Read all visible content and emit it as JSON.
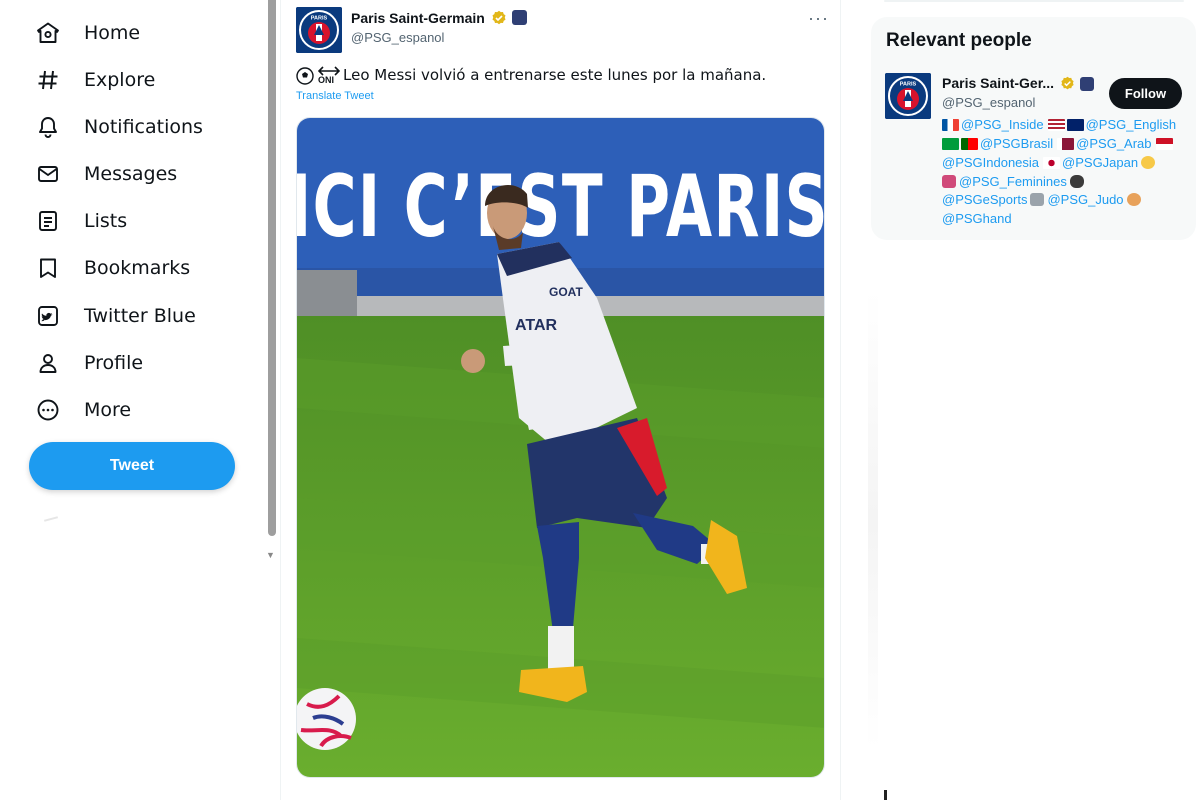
{
  "nav": {
    "items": [
      {
        "label": "Home",
        "icon": "home-icon"
      },
      {
        "label": "Explore",
        "icon": "hashtag-icon"
      },
      {
        "label": "Notifications",
        "icon": "bell-icon"
      },
      {
        "label": "Messages",
        "icon": "envelope-icon"
      },
      {
        "label": "Lists",
        "icon": "list-icon"
      },
      {
        "label": "Bookmarks",
        "icon": "bookmark-icon"
      },
      {
        "label": "Twitter Blue",
        "icon": "twitter-blue-icon"
      },
      {
        "label": "Profile",
        "icon": "person-icon"
      },
      {
        "label": "More",
        "icon": "more-circle-icon"
      }
    ],
    "tweet_button": "Tweet"
  },
  "tweet": {
    "author_name": "Paris Saint-Germain",
    "author_handle": "@PSG_espanol",
    "avatar_text": "PARIS",
    "emoji_prefix": "ONI",
    "text": "Leo Messi volvió a entrenarse este lunes por la mañana.",
    "translate_label": "Translate Tweet",
    "more_label": "···",
    "photo": {
      "banner_text": "ICI C’EST PARIS",
      "shirt_sponsor": "ATAR",
      "shirt_brand": "GOAT"
    }
  },
  "relevant_people": {
    "title": "Relevant people",
    "person": {
      "name": "Paris Saint-Ger...",
      "handle": "@PSG_espanol",
      "follow_label": "Follow",
      "bio_lines": [
        [
          {
            "flag": "fr"
          },
          {
            "link": "@PSG_Inside"
          },
          {
            "flag": "us"
          },
          {
            "flag": "gb"
          },
          {
            "link": "@PSG_English"
          }
        ],
        [
          {
            "flag": "br"
          },
          {
            "flag": "pt"
          },
          {
            "link": "@PSGBrasil"
          },
          {
            "flag": "qa"
          },
          {
            "link": "@PSG_Arab"
          },
          {
            "flag": "id"
          }
        ],
        [
          {
            "link": "@PSGIndonesia"
          },
          {
            "flag": "jp"
          },
          {
            "link": "@PSGJapan"
          },
          {
            "emoji": "face"
          }
        ],
        [
          {
            "emoji": "female"
          },
          {
            "link": "@PSG_Feminines"
          },
          {
            "emoji": "gamepad"
          }
        ],
        [
          {
            "link": "@PSGeSports"
          },
          {
            "emoji": "judo"
          },
          {
            "link": "@PSG_Judo"
          },
          {
            "emoji": "handball"
          }
        ],
        [
          {
            "link": "@PSGhand"
          }
        ]
      ]
    }
  },
  "colors": {
    "accent": "#1d9bf0",
    "text": "#0f1419",
    "muted": "#536471",
    "verified_gold": "#e2b719",
    "psg_navy": "#0a3a7e"
  }
}
